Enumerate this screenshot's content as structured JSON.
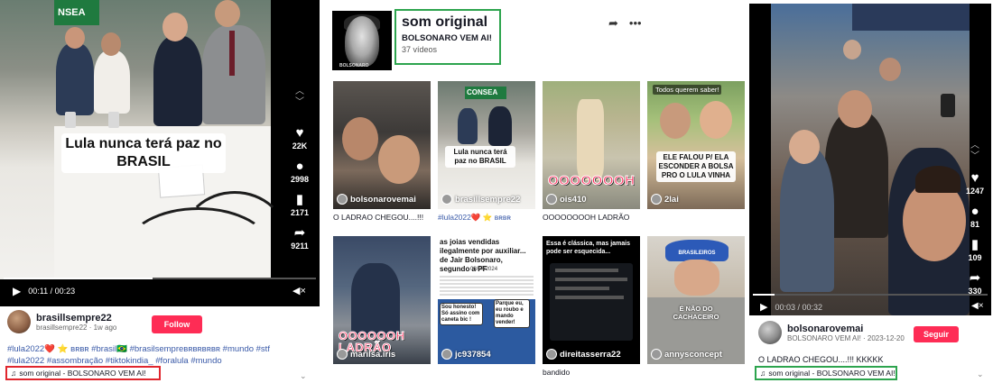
{
  "left": {
    "video_caption": "Lula nunca terá paz no BRASIL",
    "banner_fragment": "NSEA",
    "likes": "22K",
    "comments": "2998",
    "saves": "2171",
    "shares": "9211",
    "time": "00:11 / 00:23",
    "progress": 0.478,
    "author": "brasillsempre22",
    "author_sub": "brasillsempre22 · 1w ago",
    "follow_label": "Follow",
    "hashtags": "#lula2022❤️ ⭐ ʙʀʙʀ #brasil🇧🇷 #brasilsempreʙʀʙʀʙʀʙʀ #mundo #stf #lula2022 #assombração #tiktokindia_ #foralula #mundo",
    "music": "som original - BOLSONARO VEM AI!",
    "music_highlight": "#e0262e"
  },
  "middle": {
    "cover_label": "BOLSONARO",
    "sound_title": "som original",
    "sound_author": "BOLSONARO VEM AI!",
    "video_count": "37 vídeos",
    "highlight": "#2da44e",
    "tiles": [
      {
        "user": "bolsonarovemai",
        "caption": "O LADRAO CHEGOU....!!!"
      },
      {
        "user": "brasillsempre22",
        "overlay": "Lula nunca terá paz no BRASIL",
        "caption": "#lula2022❤️ ⭐ ʙʀʙʀ",
        "banner": "CONSEA"
      },
      {
        "user": "ois410",
        "big": "OOOOOOOH",
        "caption": "OOOOOOOOH LADRÃO"
      },
      {
        "user": "2lai",
        "top": "Todos querem saber!",
        "overlay": "ELE FALOU P/ ELA ESCONDER A BOLSA PRO O LULA VINHA",
        "caption": ""
      },
      {
        "user": "marilsa.iris",
        "big": "OOOOOOH LADRÃO",
        "caption": ""
      },
      {
        "user": "jc937854",
        "headline": "as joias vendidas ilegalmente por auxiliar... de Jair Bolsonaro, segundo a PF",
        "date": "08/07/2024",
        "bubble1": "Sou honesto! Só assino com caneta bic !",
        "bubble2": "Parque eu, eu roubo e mando vender!",
        "caption": ""
      },
      {
        "user": "direitasserra22",
        "headline": "Essa é clássica, mas jamais pode ser esquecida...",
        "caption": "bandido"
      },
      {
        "user": "annysconcept",
        "cap_text": "BRASILEIROS",
        "lower": "É NÃO DO CACHACEIRO",
        "caption": ""
      }
    ]
  },
  "right": {
    "likes": "1247",
    "comments": "81",
    "saves": "109",
    "shares": "330",
    "time": "00:03 / 00:32",
    "progress": 0.094,
    "author": "bolsonarovemai",
    "author_sub": "BOLSONARO VEM AI! · 2023-12-20",
    "follow_label": "Seguir",
    "description": "O LADRAO CHEGOU....!!! KKKKK",
    "music": "som original - BOLSONARO VEM AI!",
    "music_highlight": "#2da44e"
  }
}
